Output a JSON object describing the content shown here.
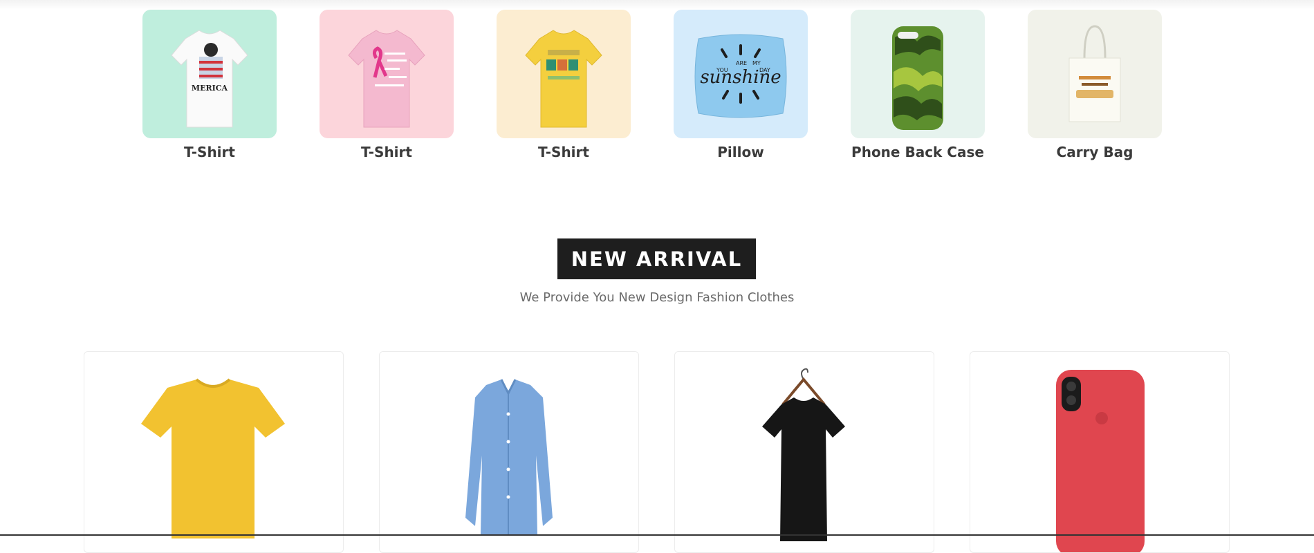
{
  "categories": [
    {
      "label": "T-Shirt",
      "bg": "#bfeedd",
      "print": "MERICA"
    },
    {
      "label": "T-Shirt",
      "bg": "#fcd5db"
    },
    {
      "label": "T-Shirt",
      "bg": "#fcedd1"
    },
    {
      "label": "Pillow",
      "bg": "#d5ebfb",
      "print_words": [
        "YOU",
        "ARE",
        "MY",
        "sunshine",
        "DAY"
      ]
    },
    {
      "label": "Phone Back Case",
      "bg": "#e6f3ee"
    },
    {
      "label": "Carry Bag",
      "bg": "#f1f2ea"
    }
  ],
  "section": {
    "title": "NEW ARRIVAL",
    "subtitle": "We Provide You New Design Fashion Clothes"
  },
  "products": [
    {
      "name": "yellow-tshirt",
      "color": "#f2c230"
    },
    {
      "name": "blue-shirt",
      "color": "#7ba7dc"
    },
    {
      "name": "black-tshirt",
      "color": "#161616"
    },
    {
      "name": "red-phone-case",
      "color": "#e0464f"
    }
  ]
}
